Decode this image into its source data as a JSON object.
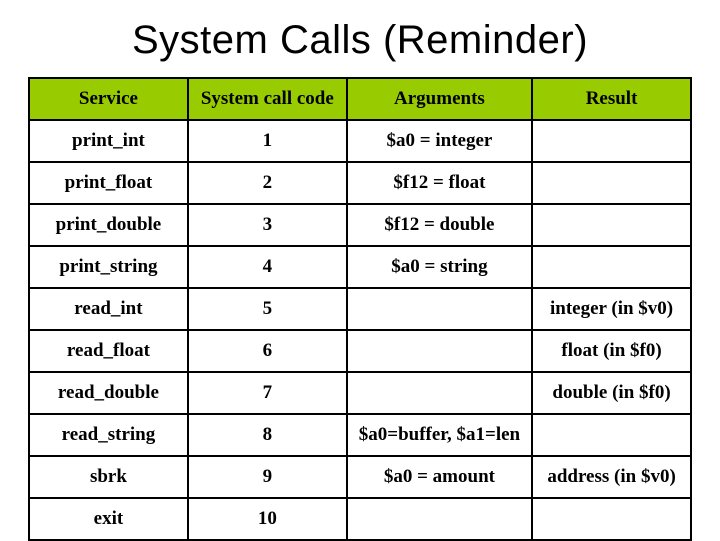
{
  "title": "System Calls (Reminder)",
  "headers": {
    "service": "Service",
    "code": "System call code",
    "args": "Arguments",
    "result": "Result"
  },
  "rows": [
    {
      "service": "print_int",
      "code": "1",
      "args": "$a0 = integer",
      "result": ""
    },
    {
      "service": "print_float",
      "code": "2",
      "args": "$f12 = float",
      "result": ""
    },
    {
      "service": "print_double",
      "code": "3",
      "args": "$f12 = double",
      "result": ""
    },
    {
      "service": "print_string",
      "code": "4",
      "args": "$a0 = string",
      "result": ""
    },
    {
      "service": "read_int",
      "code": "5",
      "args": "",
      "result": "integer (in $v0)"
    },
    {
      "service": "read_float",
      "code": "6",
      "args": "",
      "result": "float (in $f0)"
    },
    {
      "service": "read_double",
      "code": "7",
      "args": "",
      "result": "double (in $f0)"
    },
    {
      "service": "read_string",
      "code": "8",
      "args": "$a0=buffer, $a1=len",
      "result": ""
    },
    {
      "service": "sbrk",
      "code": "9",
      "args": "$a0 = amount",
      "result": "address (in $v0)"
    },
    {
      "service": "exit",
      "code": "10",
      "args": "",
      "result": ""
    }
  ],
  "chart_data": {
    "type": "table",
    "title": "System Calls (Reminder)",
    "columns": [
      "Service",
      "System call code",
      "Arguments",
      "Result"
    ],
    "rows": [
      [
        "print_int",
        1,
        "$a0 = integer",
        ""
      ],
      [
        "print_float",
        2,
        "$f12 = float",
        ""
      ],
      [
        "print_double",
        3,
        "$f12 = double",
        ""
      ],
      [
        "print_string",
        4,
        "$a0 = string",
        ""
      ],
      [
        "read_int",
        5,
        "",
        "integer (in $v0)"
      ],
      [
        "read_float",
        6,
        "",
        "float (in $f0)"
      ],
      [
        "read_double",
        7,
        "",
        "double (in $f0)"
      ],
      [
        "read_string",
        8,
        "$a0=buffer, $a1=len",
        ""
      ],
      [
        "sbrk",
        9,
        "$a0 = amount",
        "address (in $v0)"
      ],
      [
        "exit",
        10,
        "",
        ""
      ]
    ]
  }
}
